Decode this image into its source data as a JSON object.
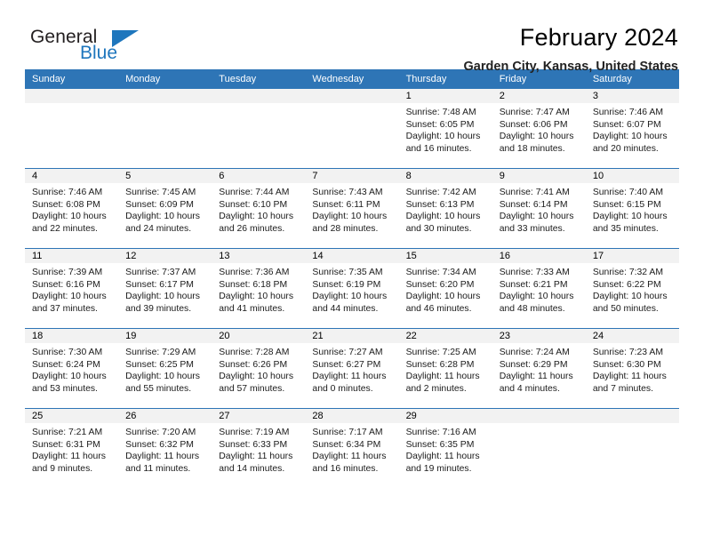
{
  "brand": {
    "name_top": "General",
    "name_bottom": "Blue",
    "accent_color": "#1e76bd"
  },
  "header": {
    "title": "February 2024",
    "subtitle": "Garden City, Kansas, United States"
  },
  "calendar": {
    "header_bg": "#2e75b6",
    "daynum_bg": "#f2f2f2",
    "weekdays": [
      "Sunday",
      "Monday",
      "Tuesday",
      "Wednesday",
      "Thursday",
      "Friday",
      "Saturday"
    ],
    "weeks": [
      [
        {
          "day": "",
          "lines": []
        },
        {
          "day": "",
          "lines": []
        },
        {
          "day": "",
          "lines": []
        },
        {
          "day": "",
          "lines": []
        },
        {
          "day": "1",
          "lines": [
            "Sunrise: 7:48 AM",
            "Sunset: 6:05 PM",
            "Daylight: 10 hours",
            "and 16 minutes."
          ]
        },
        {
          "day": "2",
          "lines": [
            "Sunrise: 7:47 AM",
            "Sunset: 6:06 PM",
            "Daylight: 10 hours",
            "and 18 minutes."
          ]
        },
        {
          "day": "3",
          "lines": [
            "Sunrise: 7:46 AM",
            "Sunset: 6:07 PM",
            "Daylight: 10 hours",
            "and 20 minutes."
          ]
        }
      ],
      [
        {
          "day": "4",
          "lines": [
            "Sunrise: 7:46 AM",
            "Sunset: 6:08 PM",
            "Daylight: 10 hours",
            "and 22 minutes."
          ]
        },
        {
          "day": "5",
          "lines": [
            "Sunrise: 7:45 AM",
            "Sunset: 6:09 PM",
            "Daylight: 10 hours",
            "and 24 minutes."
          ]
        },
        {
          "day": "6",
          "lines": [
            "Sunrise: 7:44 AM",
            "Sunset: 6:10 PM",
            "Daylight: 10 hours",
            "and 26 minutes."
          ]
        },
        {
          "day": "7",
          "lines": [
            "Sunrise: 7:43 AM",
            "Sunset: 6:11 PM",
            "Daylight: 10 hours",
            "and 28 minutes."
          ]
        },
        {
          "day": "8",
          "lines": [
            "Sunrise: 7:42 AM",
            "Sunset: 6:13 PM",
            "Daylight: 10 hours",
            "and 30 minutes."
          ]
        },
        {
          "day": "9",
          "lines": [
            "Sunrise: 7:41 AM",
            "Sunset: 6:14 PM",
            "Daylight: 10 hours",
            "and 33 minutes."
          ]
        },
        {
          "day": "10",
          "lines": [
            "Sunrise: 7:40 AM",
            "Sunset: 6:15 PM",
            "Daylight: 10 hours",
            "and 35 minutes."
          ]
        }
      ],
      [
        {
          "day": "11",
          "lines": [
            "Sunrise: 7:39 AM",
            "Sunset: 6:16 PM",
            "Daylight: 10 hours",
            "and 37 minutes."
          ]
        },
        {
          "day": "12",
          "lines": [
            "Sunrise: 7:37 AM",
            "Sunset: 6:17 PM",
            "Daylight: 10 hours",
            "and 39 minutes."
          ]
        },
        {
          "day": "13",
          "lines": [
            "Sunrise: 7:36 AM",
            "Sunset: 6:18 PM",
            "Daylight: 10 hours",
            "and 41 minutes."
          ]
        },
        {
          "day": "14",
          "lines": [
            "Sunrise: 7:35 AM",
            "Sunset: 6:19 PM",
            "Daylight: 10 hours",
            "and 44 minutes."
          ]
        },
        {
          "day": "15",
          "lines": [
            "Sunrise: 7:34 AM",
            "Sunset: 6:20 PM",
            "Daylight: 10 hours",
            "and 46 minutes."
          ]
        },
        {
          "day": "16",
          "lines": [
            "Sunrise: 7:33 AM",
            "Sunset: 6:21 PM",
            "Daylight: 10 hours",
            "and 48 minutes."
          ]
        },
        {
          "day": "17",
          "lines": [
            "Sunrise: 7:32 AM",
            "Sunset: 6:22 PM",
            "Daylight: 10 hours",
            "and 50 minutes."
          ]
        }
      ],
      [
        {
          "day": "18",
          "lines": [
            "Sunrise: 7:30 AM",
            "Sunset: 6:24 PM",
            "Daylight: 10 hours",
            "and 53 minutes."
          ]
        },
        {
          "day": "19",
          "lines": [
            "Sunrise: 7:29 AM",
            "Sunset: 6:25 PM",
            "Daylight: 10 hours",
            "and 55 minutes."
          ]
        },
        {
          "day": "20",
          "lines": [
            "Sunrise: 7:28 AM",
            "Sunset: 6:26 PM",
            "Daylight: 10 hours",
            "and 57 minutes."
          ]
        },
        {
          "day": "21",
          "lines": [
            "Sunrise: 7:27 AM",
            "Sunset: 6:27 PM",
            "Daylight: 11 hours",
            "and 0 minutes."
          ]
        },
        {
          "day": "22",
          "lines": [
            "Sunrise: 7:25 AM",
            "Sunset: 6:28 PM",
            "Daylight: 11 hours",
            "and 2 minutes."
          ]
        },
        {
          "day": "23",
          "lines": [
            "Sunrise: 7:24 AM",
            "Sunset: 6:29 PM",
            "Daylight: 11 hours",
            "and 4 minutes."
          ]
        },
        {
          "day": "24",
          "lines": [
            "Sunrise: 7:23 AM",
            "Sunset: 6:30 PM",
            "Daylight: 11 hours",
            "and 7 minutes."
          ]
        }
      ],
      [
        {
          "day": "25",
          "lines": [
            "Sunrise: 7:21 AM",
            "Sunset: 6:31 PM",
            "Daylight: 11 hours",
            "and 9 minutes."
          ]
        },
        {
          "day": "26",
          "lines": [
            "Sunrise: 7:20 AM",
            "Sunset: 6:32 PM",
            "Daylight: 11 hours",
            "and 11 minutes."
          ]
        },
        {
          "day": "27",
          "lines": [
            "Sunrise: 7:19 AM",
            "Sunset: 6:33 PM",
            "Daylight: 11 hours",
            "and 14 minutes."
          ]
        },
        {
          "day": "28",
          "lines": [
            "Sunrise: 7:17 AM",
            "Sunset: 6:34 PM",
            "Daylight: 11 hours",
            "and 16 minutes."
          ]
        },
        {
          "day": "29",
          "lines": [
            "Sunrise: 7:16 AM",
            "Sunset: 6:35 PM",
            "Daylight: 11 hours",
            "and 19 minutes."
          ]
        },
        {
          "day": "",
          "lines": []
        },
        {
          "day": "",
          "lines": []
        }
      ]
    ]
  }
}
